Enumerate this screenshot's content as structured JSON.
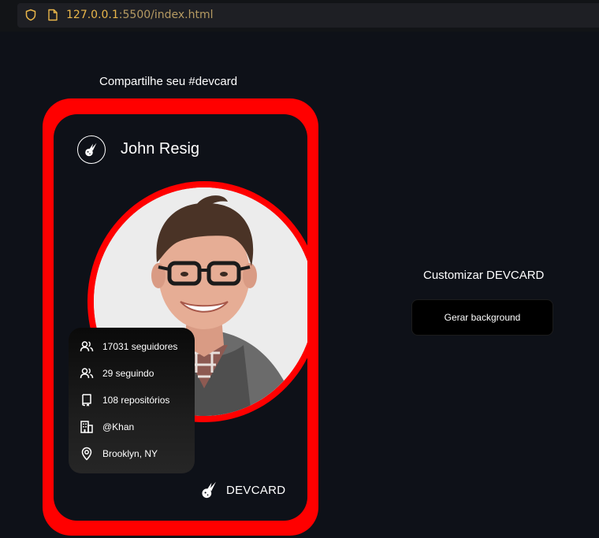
{
  "browser": {
    "url_host": "127.0.0.1",
    "url_path": ":5500/index.html"
  },
  "share_title": "Compartilhe seu #devcard",
  "card": {
    "frame_color": "#ff0000",
    "user_name": "John Resig",
    "stats": [
      {
        "icon": "followers-icon",
        "text": "17031 seguidores"
      },
      {
        "icon": "following-icon",
        "text": "29 seguindo"
      },
      {
        "icon": "repository-icon",
        "text": "108 repositórios"
      },
      {
        "icon": "company-icon",
        "text": "@Khan"
      },
      {
        "icon": "location-pin-icon",
        "text": "Brooklyn, NY"
      }
    ],
    "brand": "DEVCARD"
  },
  "customize": {
    "title": "Customizar DEVCARD",
    "button_label": "Gerar background"
  }
}
